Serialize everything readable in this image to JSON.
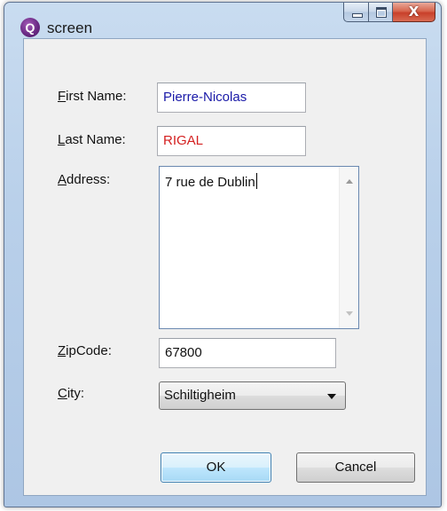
{
  "window": {
    "title": "screen",
    "icon": "qt-app-icon",
    "icon_glyph": "Q",
    "close_glyph": "X"
  },
  "form": {
    "first_name": {
      "label_accel": "F",
      "label_rest": "irst Name:",
      "value": "Pierre-Nicolas",
      "color": "#1a1aa8"
    },
    "last_name": {
      "label_accel": "L",
      "label_rest": "ast Name:",
      "value": "RIGAL",
      "color": "#d42020"
    },
    "address": {
      "label_accel": "A",
      "label_rest": "ddress:",
      "value": "7 rue de Dublin"
    },
    "zipcode": {
      "label_accel": "Z",
      "label_rest": "ipCode:",
      "value": "67800"
    },
    "city": {
      "label_accel": "C",
      "label_rest": "ity:",
      "value": "Schiltigheim"
    }
  },
  "buttons": {
    "ok": "OK",
    "cancel": "Cancel"
  }
}
